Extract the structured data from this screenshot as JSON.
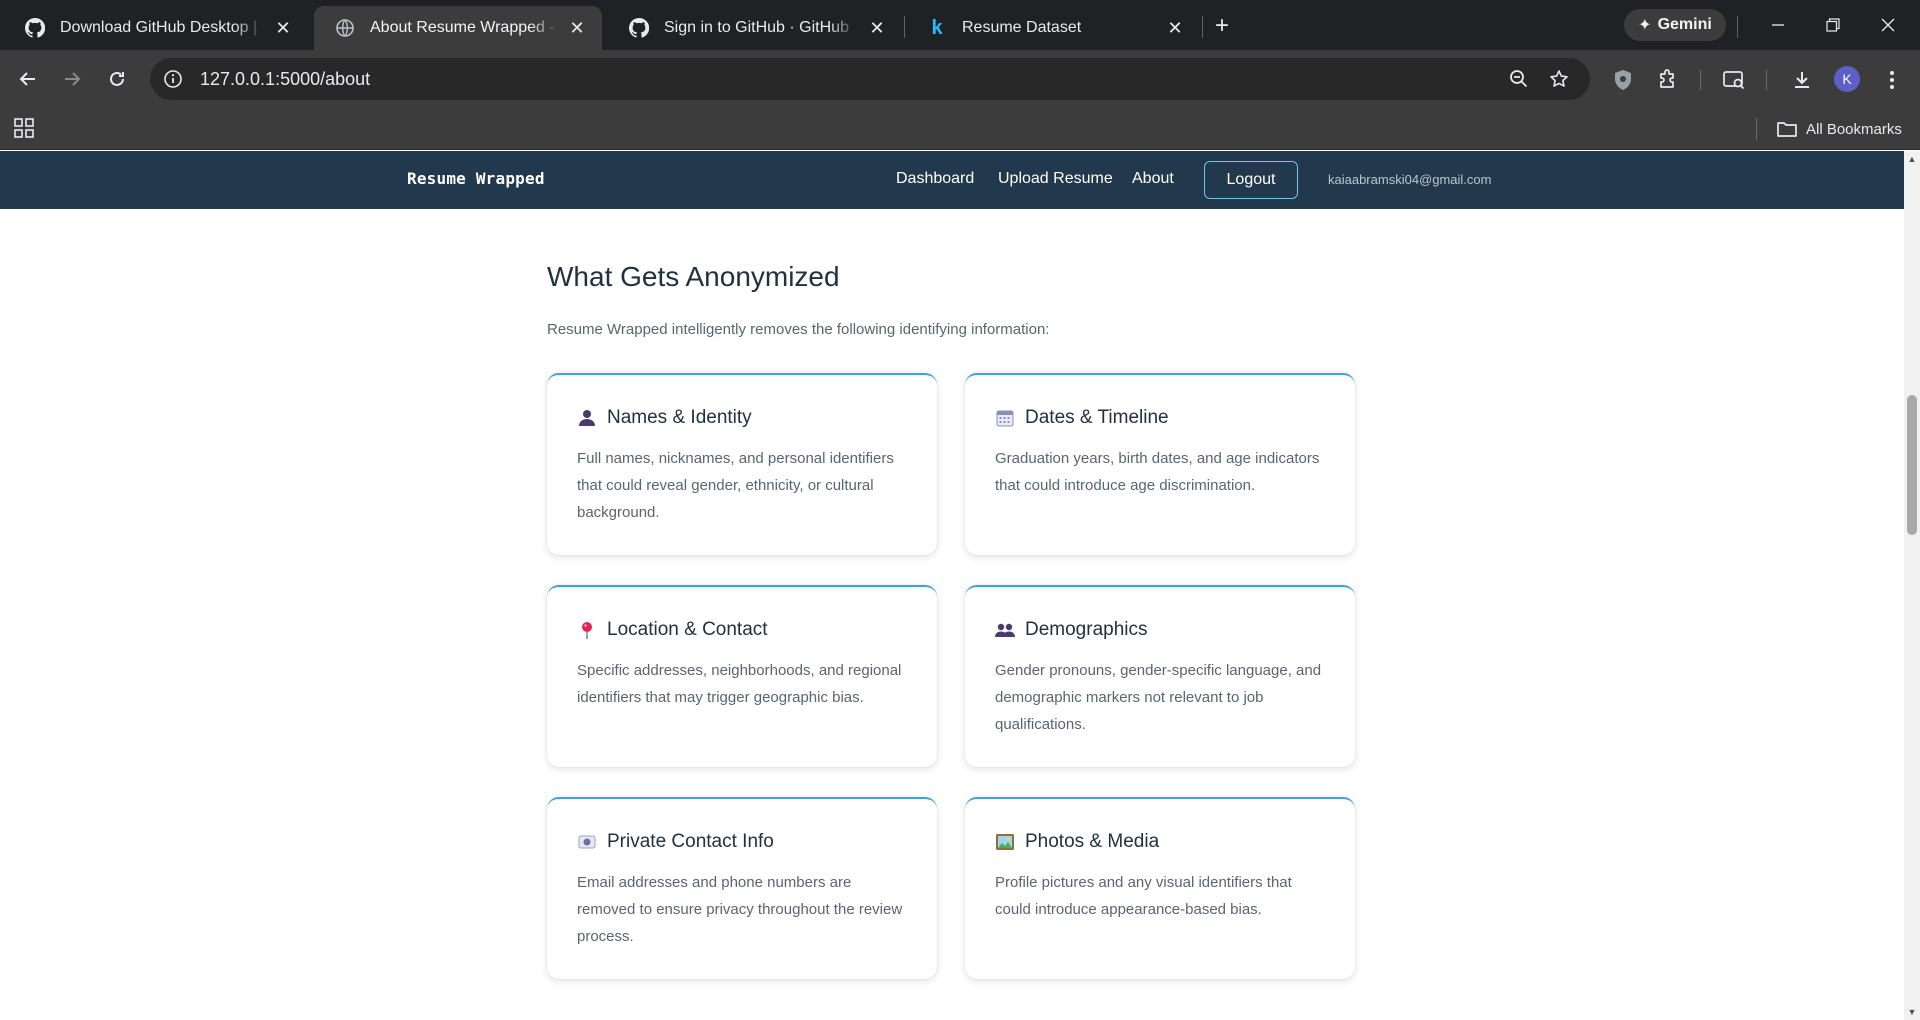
{
  "browser": {
    "tabs": [
      {
        "title": "Download GitHub Desktop | GitHub",
        "icon": "github-icon",
        "active": false
      },
      {
        "title": "About Resume Wrapped - Fair Hiring",
        "icon": "globe-icon",
        "active": true
      },
      {
        "title": "Sign in to GitHub · GitHub",
        "icon": "github-icon",
        "active": false
      },
      {
        "title": "Resume Dataset",
        "icon": "kaggle-icon",
        "active": false
      }
    ],
    "gemini_label": "Gemini",
    "url": "127.0.0.1:5000/about",
    "profile_initial": "K",
    "all_bookmarks_label": "All Bookmarks"
  },
  "app": {
    "brand": "Resume Wrapped",
    "nav": {
      "dashboard": "Dashboard",
      "upload": "Upload Resume",
      "about": "About",
      "logout": "Logout",
      "user_email": "kaiaabramski04@gmail.com"
    }
  },
  "section": {
    "title": "What Gets Anonymized",
    "intro": "Resume Wrapped intelligently removes the following identifying information:",
    "cards": [
      {
        "icon": "person-icon",
        "title": "Names & Identity",
        "text": "Full names, nicknames, and personal identifiers that could reveal gender, ethnicity, or cultural background."
      },
      {
        "icon": "calendar-icon",
        "title": "Dates & Timeline",
        "text": "Graduation years, birth dates, and age indicators that could introduce age discrimination."
      },
      {
        "icon": "pushpin-icon",
        "title": "Location & Contact",
        "text": "Specific addresses, neighborhoods, and regional identifiers that may trigger geographic bias."
      },
      {
        "icon": "people-icon",
        "title": "Demographics",
        "text": "Gender pronouns, gender-specific language, and demographic markers not relevant to job qualifications."
      },
      {
        "icon": "id-card-icon",
        "title": "Private Contact Info",
        "text": "Email addresses and phone numbers are removed to ensure privacy throughout the review process."
      },
      {
        "icon": "picture-icon",
        "title": "Photos & Media",
        "text": "Profile pictures and any visual identifiers that could introduce appearance-based bias."
      }
    ]
  },
  "colors": {
    "navbar": "#22394d",
    "accent": "#3aa6d6",
    "heading": "#22313f",
    "body_text": "#5a6570"
  }
}
